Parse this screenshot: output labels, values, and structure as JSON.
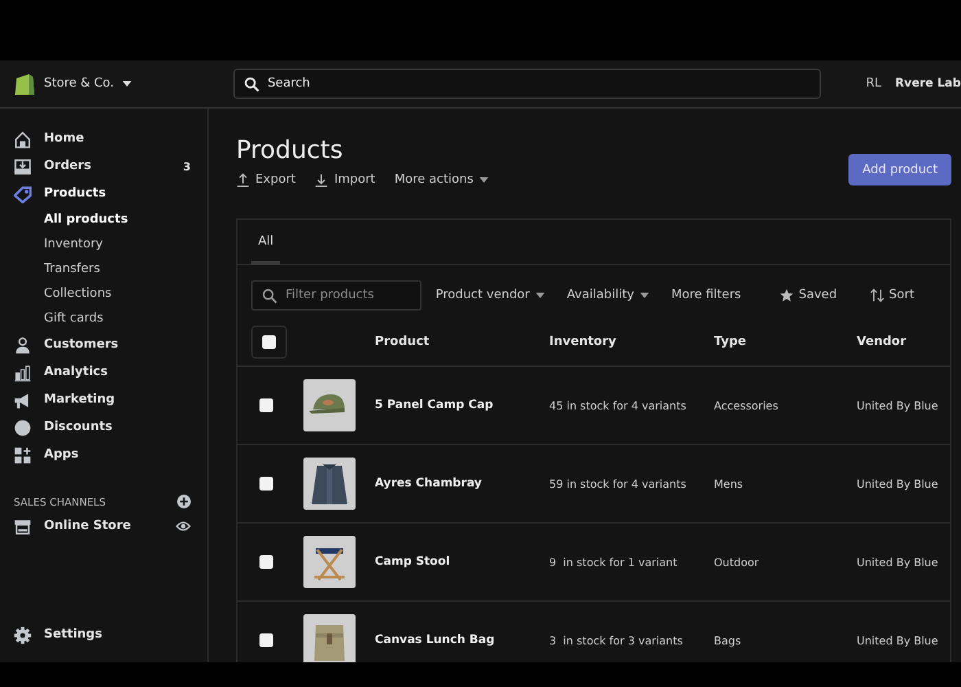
{
  "store": {
    "name": "Store & Co."
  },
  "search": {
    "placeholder": "Search"
  },
  "account": {
    "initials": "RL",
    "name": "Rvere Lab"
  },
  "sidebar": {
    "items": [
      {
        "kind": "home",
        "label": "Home",
        "selected": false
      },
      {
        "kind": "orders",
        "label": "Orders",
        "badge": "3",
        "selected": false
      },
      {
        "kind": "products",
        "label": "Products",
        "selected": true,
        "children": [
          {
            "label": "All products",
            "selected": true
          },
          {
            "label": "Inventory",
            "selected": false
          },
          {
            "label": "Transfers",
            "selected": false
          },
          {
            "label": "Collections",
            "selected": false
          },
          {
            "label": "Gift cards",
            "selected": false
          }
        ]
      },
      {
        "kind": "customers",
        "label": "Customers",
        "selected": false
      },
      {
        "kind": "analytics",
        "label": "Analytics",
        "selected": false
      },
      {
        "kind": "marketing",
        "label": "Marketing",
        "selected": false
      },
      {
        "kind": "discounts",
        "label": "Discounts",
        "selected": false
      },
      {
        "kind": "apps",
        "label": "Apps",
        "selected": false
      }
    ],
    "section_title": "SALES CHANNELS",
    "channels": [
      {
        "label": "Online Store",
        "selected": false
      }
    ],
    "settings": {
      "label": "Settings",
      "selected": false
    }
  },
  "page": {
    "title": "Products",
    "actions": [
      {
        "kind": "export",
        "label": "Export"
      },
      {
        "kind": "import",
        "label": "Import"
      },
      {
        "kind": "more",
        "label": "More actions"
      }
    ],
    "primary_button": "Add product"
  },
  "tabs": [
    {
      "label": "All",
      "selected": true
    }
  ],
  "filters": {
    "placeholder": "Filter products",
    "buttons": [
      {
        "kind": "dropdown",
        "label": "Product vendor"
      },
      {
        "kind": "dropdown",
        "label": "Availability"
      },
      {
        "kind": "plain",
        "label": "More filters"
      },
      {
        "kind": "saved",
        "label": "Saved"
      },
      {
        "kind": "sort",
        "label": "Sort"
      }
    ]
  },
  "table": {
    "select_all": {
      "checked": false
    },
    "columns": [
      "Product",
      "Inventory",
      "Type",
      "Vendor"
    ],
    "rows": [
      {
        "checked": false,
        "product": "5 Panel Camp Cap",
        "inventory": "45 in stock for 4 variants",
        "type": "Accessories",
        "vendor": "United By Blue"
      },
      {
        "checked": false,
        "product": "Ayres Chambray",
        "inventory": "59 in stock for 4 variants",
        "type": "Mens",
        "vendor": "United By Blue"
      },
      {
        "checked": false,
        "product": "Camp Stool",
        "inventory": "9  in stock for 1 variant",
        "type": "Outdoor",
        "vendor": "United By Blue"
      },
      {
        "checked": false,
        "product": "Canvas Lunch Bag",
        "inventory": "3  in stock for 3 variants",
        "type": "Bags",
        "vendor": "United By Blue"
      }
    ]
  }
}
